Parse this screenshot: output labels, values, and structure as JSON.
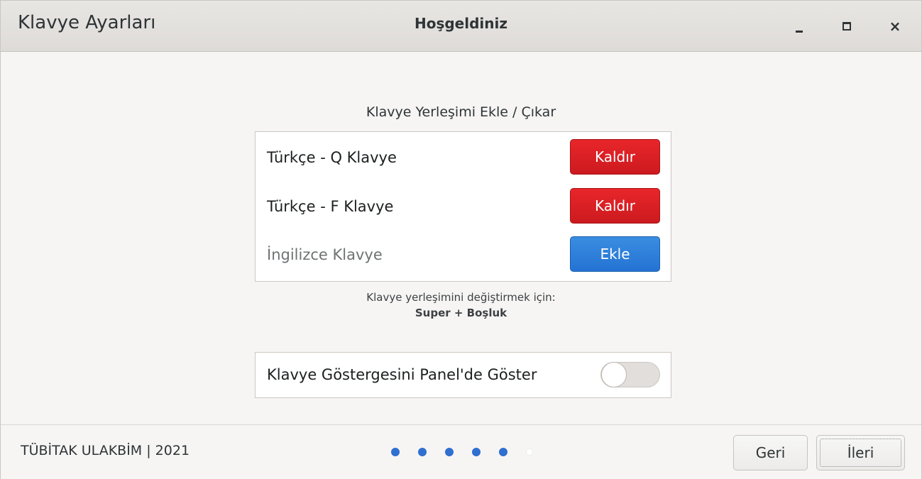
{
  "window": {
    "app_title": "Klavye Ayarları",
    "header_title": "Hoşgeldiniz",
    "controls": {
      "minimize_icon": "window-minimize-icon",
      "maximize_icon": "window-maximize-icon",
      "close_icon": "window-close-icon",
      "close_glyph": "×"
    }
  },
  "layouts": {
    "section_title": "Klavye Yerleşimi Ekle / Çıkar",
    "items": [
      {
        "label": "Türkçe - Q Klavye",
        "button": "Kaldır",
        "active": true
      },
      {
        "label": "Türkçe - F Klavye",
        "button": "Kaldır",
        "active": true
      },
      {
        "label": "İngilizce Klavye",
        "button": "Ekle",
        "active": false
      }
    ]
  },
  "hint": {
    "line1": "Klavye yerleşimini değiştirmek için:",
    "keys": "Super + Boşluk"
  },
  "indicator": {
    "label": "Klavye Göstergesini Panel'de Göster",
    "enabled": false
  },
  "footer": {
    "org": "TÜBİTAK ULAKBİM | 2021",
    "pages_total": 6,
    "current_page": 5,
    "back_label": "Geri",
    "next_label": "İleri"
  },
  "colors": {
    "remove_button": "#d71f24",
    "add_button": "#2f80d8",
    "progress_dot": "#2f6fd0"
  }
}
